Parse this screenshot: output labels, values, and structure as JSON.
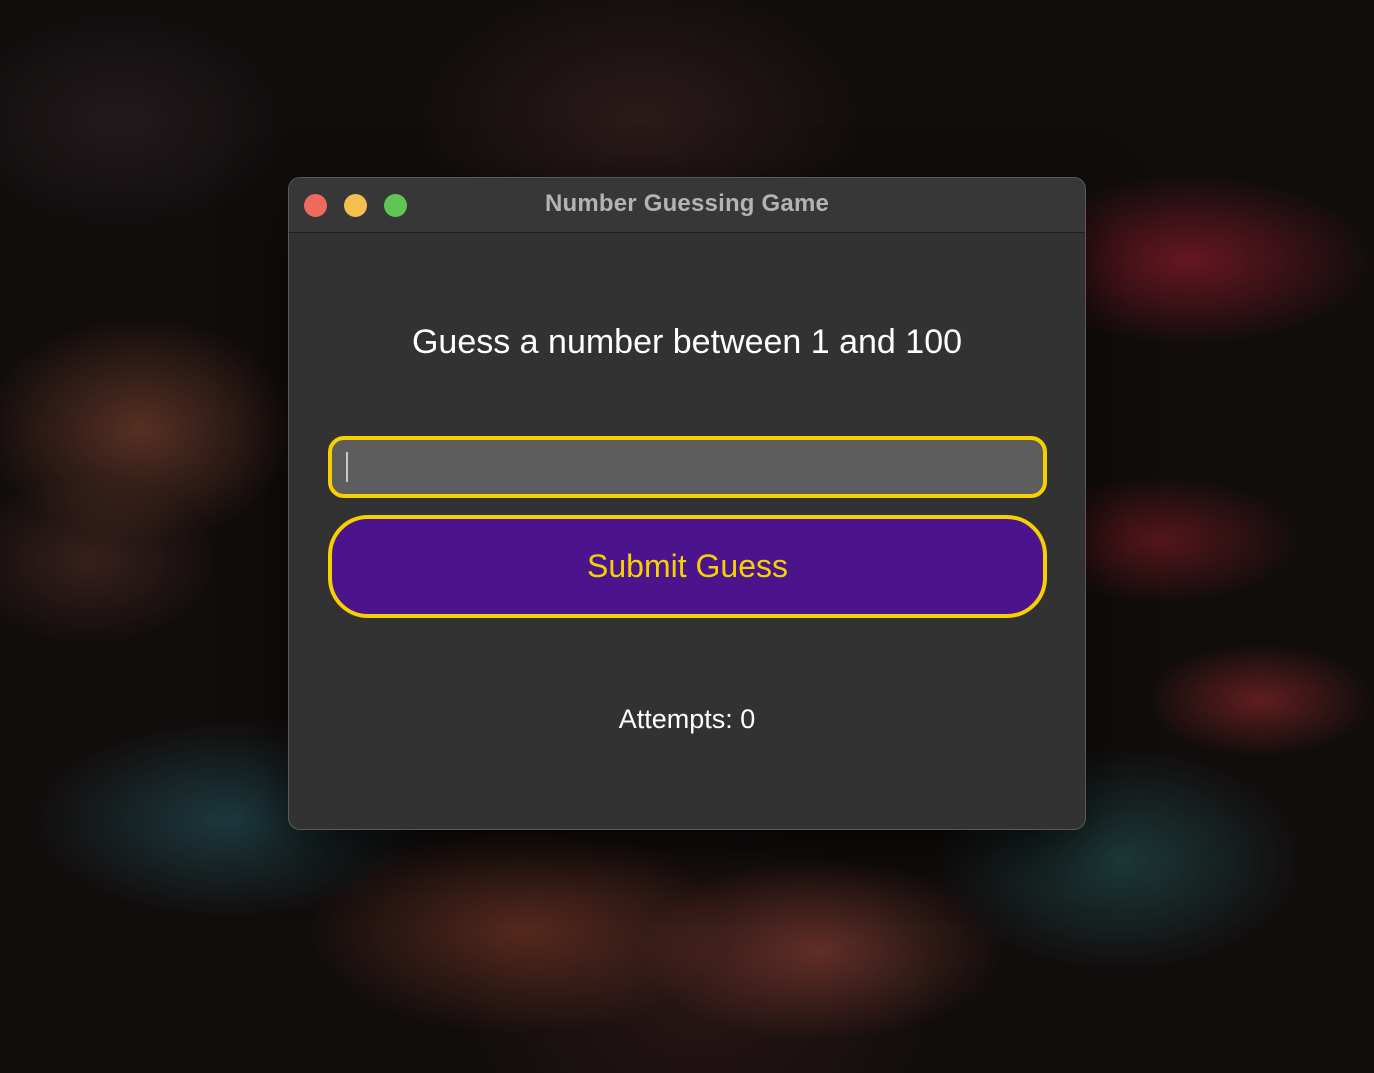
{
  "window": {
    "title": "Number Guessing Game"
  },
  "traffic_lights": {
    "close_color": "#ec6a5e",
    "minimize_color": "#f4bf4f",
    "zoom_color": "#61c554"
  },
  "game": {
    "prompt": "Guess a number between 1 and 100",
    "guess_input_value": "",
    "submit_label": "Submit Guess",
    "attempts_text": "Attempts: 0"
  },
  "colors": {
    "accent_border": "#f5d100",
    "button_background": "#4b148c",
    "window_background": "#323232"
  }
}
